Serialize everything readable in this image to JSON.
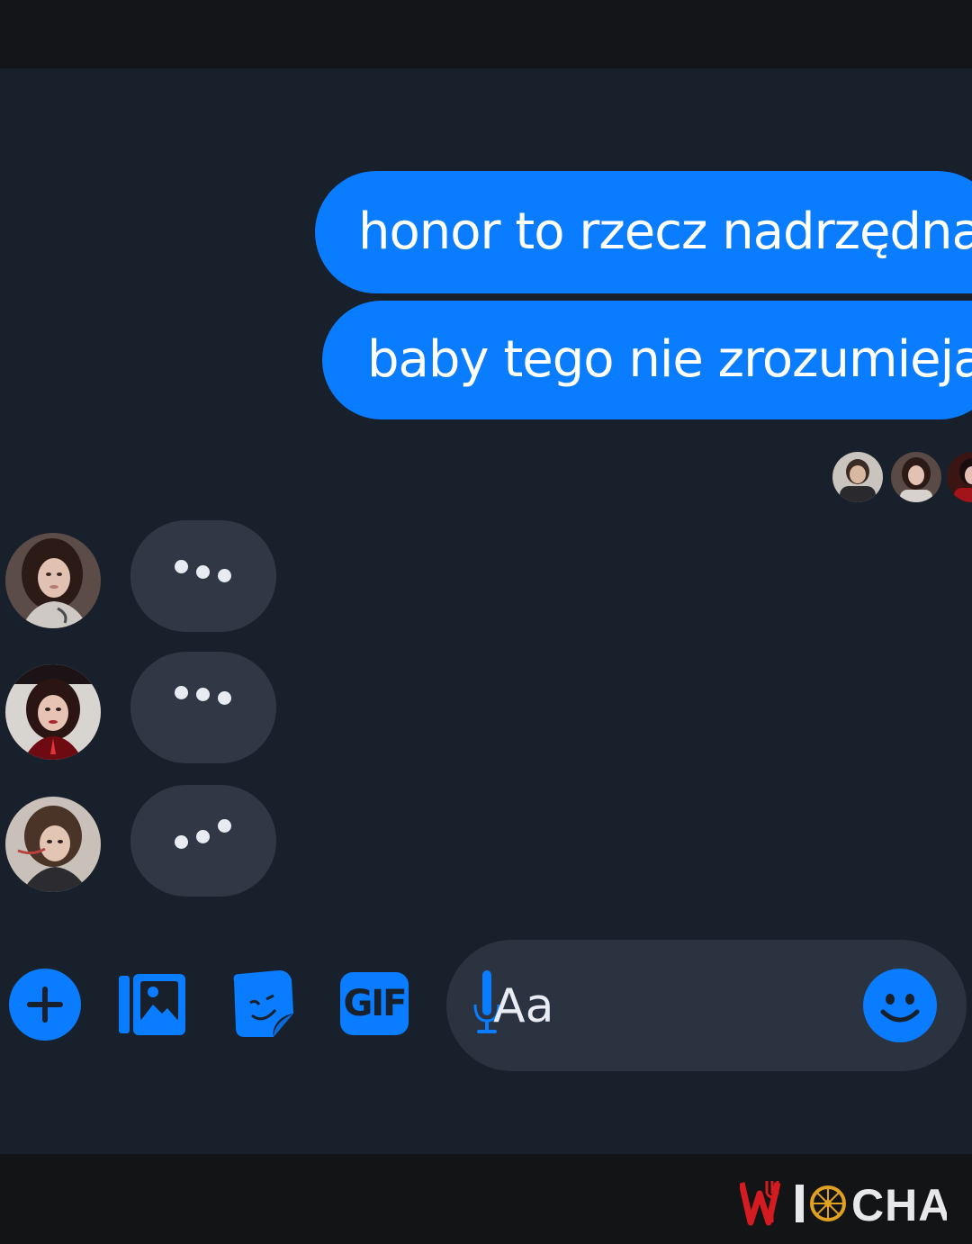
{
  "conversation": {
    "outgoing_messages": [
      {
        "text": "honor to rzecz nadrzędna"
      },
      {
        "text": "baby tego nie zrozumieją"
      }
    ],
    "seen_by_count": 3,
    "typing_participants": [
      {
        "avatar": "participant-1-avatar",
        "indicator": "typing-dots"
      },
      {
        "avatar": "participant-2-avatar",
        "indicator": "typing-dots"
      },
      {
        "avatar": "participant-3-avatar",
        "indicator": "typing-dots"
      }
    ]
  },
  "composer": {
    "placeholder": "Aa",
    "gif_label": "GIF",
    "icons": [
      "plus-icon",
      "gallery-icon",
      "sticker-icon",
      "gif-icon",
      "microphone-icon",
      "emoji-icon"
    ]
  },
  "watermark": {
    "text": "WIOCHA"
  },
  "colors": {
    "accent": "#0a7cff",
    "background": "#18202b",
    "typing_bubble": "#2f3844",
    "watermark_red": "#d41b20"
  }
}
